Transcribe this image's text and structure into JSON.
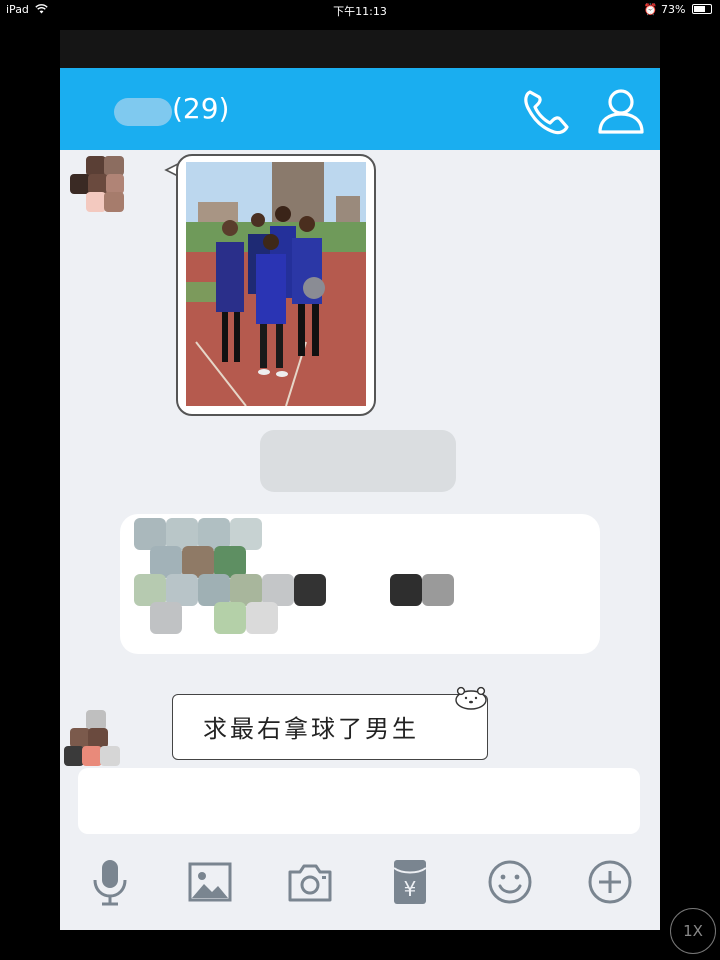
{
  "status_bar": {
    "device": "iPad",
    "time": "下午11:13",
    "battery": "73%"
  },
  "chat": {
    "member_count": "(29)"
  },
  "messages": [
    {
      "type": "image"
    },
    {
      "type": "note",
      "text": "求最右拿球了男生"
    }
  ],
  "toolbar": {
    "items": [
      "microphone-icon",
      "image-icon",
      "camera-icon",
      "red-packet-icon",
      "emoji-icon",
      "plus-icon"
    ]
  },
  "overlay": {
    "speed_label": "1X"
  },
  "colors": {
    "header": "#1aaef0",
    "background": "#eef0f4",
    "icon": "#7a8590"
  }
}
